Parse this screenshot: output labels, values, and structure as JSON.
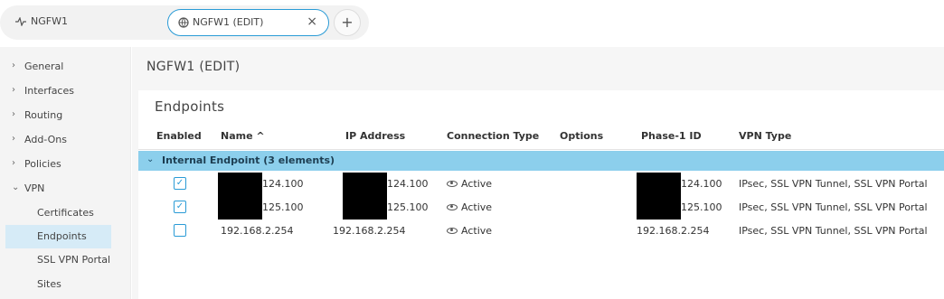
{
  "tabs": {
    "tab1": {
      "label": "NGFW1",
      "icon": "activity-icon"
    },
    "active_tab": {
      "label": "NGFW1 (EDIT)",
      "icon": "globe-settings-icon",
      "close": "×"
    },
    "add": "+"
  },
  "sidebar": {
    "items": [
      {
        "label": "General",
        "chevron": "›"
      },
      {
        "label": "Interfaces",
        "chevron": "›"
      },
      {
        "label": "Routing",
        "chevron": "›"
      },
      {
        "label": "Add-Ons",
        "chevron": "›"
      },
      {
        "label": "Policies",
        "chevron": "›"
      },
      {
        "label": "VPN",
        "chevron": "⌄"
      }
    ],
    "vpn_children": [
      {
        "label": "Certificates"
      },
      {
        "label": "Endpoints",
        "active": true
      },
      {
        "label": "SSL VPN Portal"
      },
      {
        "label": "Sites"
      }
    ]
  },
  "main": {
    "title": "NGFW1 (EDIT)",
    "section_title": "Endpoints",
    "columns": [
      "Enabled",
      "Name ^",
      "IP Address",
      "Connection Type",
      "Options",
      "Phase-1 ID",
      "VPN Type"
    ],
    "group": {
      "chevron": "⌄",
      "label": "Internal Endpoint (3 elements)"
    },
    "rows": [
      {
        "enabled": "✓",
        "name": "124.100",
        "ip": "124.100",
        "conn": "Active",
        "options": "",
        "phase1": "124.100",
        "vpn_type": "IPsec, SSL VPN Tunnel, SSL VPN Portal"
      },
      {
        "enabled": "✓",
        "name": "125.100",
        "ip": "125.100",
        "conn": "Active",
        "options": "",
        "phase1": "125.100",
        "vpn_type": "IPsec, SSL VPN Tunnel, SSL VPN Portal"
      },
      {
        "enabled": "",
        "name": "192.168.2.254",
        "ip": "192.168.2.254",
        "conn": "Active",
        "options": "",
        "phase1": "192.168.2.254",
        "vpn_type": "IPsec, SSL VPN Tunnel, SSL VPN Portal"
      }
    ]
  },
  "colors": {
    "accent": "#2a9bd6",
    "group_row": "#8ccfec",
    "active_nav": "#d6ebf7"
  }
}
